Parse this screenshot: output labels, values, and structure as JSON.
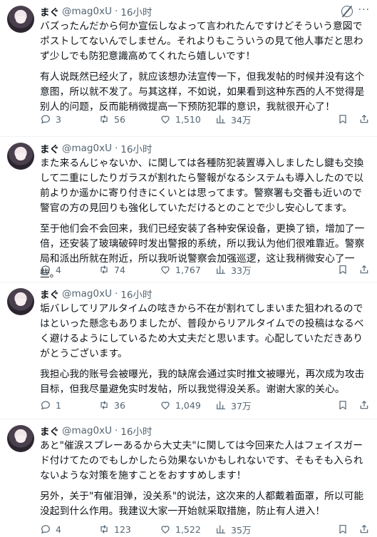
{
  "tweets": [
    {
      "name": "まぐ",
      "handle": "@mag0xU",
      "dot": "·",
      "time": "16小时",
      "original": "バズったんだから何か宣伝しなよって言われたんですけどそういう意図でポストしてないんでしません。それよりもこういうの見て他人事だと思わず少しでも防犯意識高めてくれたら嬉しいです！",
      "translation": "有人说既然已经火了，就应该想办法宣传一下，但我发帖的时候并没有这个意图，所以就不发了。与其这样，不如说，如果看到这种东西的人不觉得是别人的问题，反而能稍微提高一下预防犯罪的意识，我就很开心了！",
      "replies": "3",
      "retweets": "56",
      "likes": "1,510",
      "views": "34万"
    },
    {
      "name": "まぐ",
      "handle": "@mag0xU",
      "dot": "·",
      "time": "16小时",
      "original": "また来るんじゃないか、に関しては各種防犯装置導入しましたし鍵も交換して二重にしたりガラスが割れたら警報がなるシステムも導入したので以前よりか遥かに寄り付きにくいとは思ってます。警察署も交番も近いので警官の方の見回りも強化していただけるとのことで少し安心してます。",
      "translation": "至于他们会不会回来，我们已经安装了各种安保设备，更换了锁，增加了一倍，还安装了玻璃破碎时发出警报的系统，所以我认为他们很难靠近。警察局和派出所就在附近，所以我听说警察会加强巡逻，这让我稍微安心了一些。",
      "replies": "4",
      "retweets": "74",
      "likes": "1,767",
      "views": "33万"
    },
    {
      "name": "まぐ",
      "handle": "@mag0xU",
      "dot": "·",
      "time": "16小时",
      "original": "垢バレしてリアルタイムの呟きから不在が割れてしまいまた狙われるのではといった懸念もありましたが、普段からリアルタイムでの投稿はなるべく避けるようにしているため大丈夫だと思います。心配していただきありがとうございます。",
      "translation": "我担心我的账号会被曝光，我的缺席会通过实时推文被曝光，再次成为攻击目标，但我尽量避免实时发帖，所以我觉得没关系。谢谢大家的关心。",
      "replies": "1",
      "retweets": "36",
      "likes": "1,049",
      "views": "37万"
    },
    {
      "name": "まぐ",
      "handle": "@mag0xU",
      "dot": "·",
      "time": "16小时",
      "original": "あと\"催涙スプレーあるから大丈夫\"に関しては今回来た人はフェイスガード付けてたのでもしかしたら効果ないかもしれないです、そもそも入られないような対策を施すことをおすすめします！",
      "translation": "另外，关于\"有催泪弹，没关系\"的说法，这次来的人都戴着面罩，所以可能没起到什么作用。我建议大家一开始就采取措施，防止有人进入！",
      "replies": "4",
      "retweets": "123",
      "likes": "1,522",
      "views": "35万"
    }
  ],
  "icons": {
    "reply": "reply-icon",
    "retweet": "retweet-icon",
    "like": "heart-icon",
    "views": "views-icon",
    "bookmark": "bookmark-icon",
    "share": "share-icon",
    "grok": "grok-icon",
    "more": "more-icon"
  },
  "colors": {
    "text": "#0f1419",
    "secondary": "#536471",
    "divider": "#eff3f4"
  }
}
